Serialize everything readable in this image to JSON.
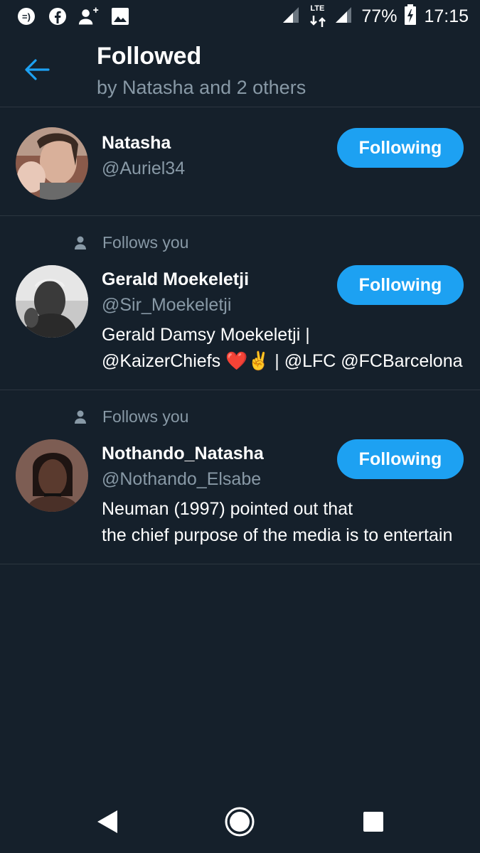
{
  "status_bar": {
    "network": "LTE",
    "battery": "77%",
    "time": "17:15",
    "left_icons": [
      "messenger-icon",
      "facebook-icon",
      "add-contact-icon",
      "gallery-icon"
    ]
  },
  "header": {
    "title": "Followed",
    "subtitle": "by Natasha and 2 others"
  },
  "users": [
    {
      "follows_you": "",
      "name": "Natasha",
      "handle": "@Auriel34",
      "bio_lines": [],
      "button": "Following"
    },
    {
      "follows_you": "Follows you",
      "name": "Gerald Moekeletji",
      "handle": "@Sir_Moekeletji",
      "bio_lines": [
        "Gerald Damsy Moekeletji |",
        "@KaizerChiefs ❤️✌️ | @LFC @FCBarcelona"
      ],
      "button": "Following"
    },
    {
      "follows_you": "Follows you",
      "name": "Nothando_Natasha",
      "handle": "@Nothando_Elsabe",
      "bio_lines": [
        "Neuman (1997) pointed out that",
        "the chief purpose of the media is to entertain"
      ],
      "button": "Following"
    }
  ],
  "colors": {
    "background": "#15202b",
    "accent": "#1da1f2",
    "secondary_text": "#8899a6"
  }
}
